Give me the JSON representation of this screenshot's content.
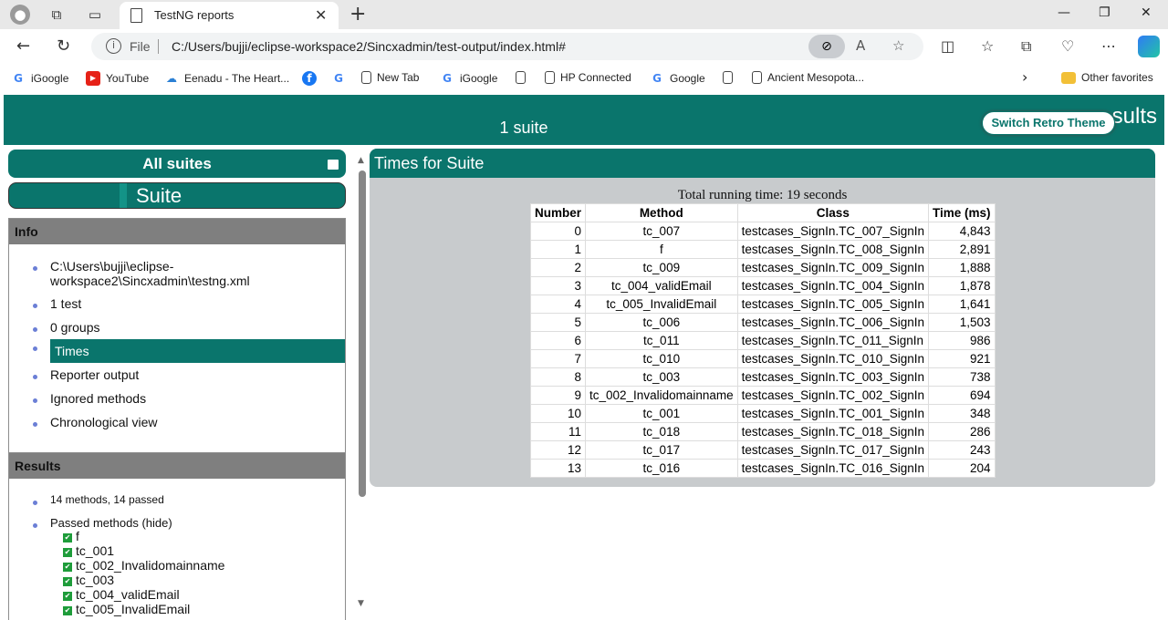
{
  "browser": {
    "tab_title": "TestNG reports",
    "url_label": "File",
    "url": "C:/Users/bujji/eclipse-workspace2/Sincxadmin/test-output/index.html#",
    "bookmarks": [
      "iGoogle",
      "YouTube",
      "Eenadu - The Heart...",
      "",
      "",
      "New Tab",
      "iGoogle",
      "",
      "HP Connected",
      "Google",
      "",
      "Ancient Mesopota..."
    ],
    "other_favorites": "Other favorites"
  },
  "report": {
    "suites_count": "1 suite",
    "title_fragment": "sults",
    "switch_theme": "Switch Retro Theme",
    "all_suites": "All suites",
    "suite_name": "Suite",
    "info_header": "Info",
    "info_items": [
      "C:\\Users\\bujji\\eclipse-workspace2\\Sincxadmin\\testng.xml",
      "1 test",
      "0 groups",
      "Times",
      "Reporter output",
      "Ignored methods",
      "Chronological view"
    ],
    "results_header": "Results",
    "results_summary": "14 methods, 14 passed",
    "passed_label": "Passed methods",
    "hide_label": "(hide)",
    "passed_methods": [
      "f",
      "tc_001",
      "tc_002_Invalidomainname",
      "tc_003",
      "tc_004_validEmail",
      "tc_005_InvalidEmail"
    ],
    "times_header": "Times for Suite",
    "total_time": "Total running time: 19 seconds",
    "columns": [
      "Number",
      "Method",
      "Class",
      "Time (ms)"
    ],
    "rows": [
      [
        "0",
        "tc_007",
        "testcases_SignIn.TC_007_SignIn",
        "4,843"
      ],
      [
        "1",
        "f",
        "testcases_SignIn.TC_008_SignIn",
        "2,891"
      ],
      [
        "2",
        "tc_009",
        "testcases_SignIn.TC_009_SignIn",
        "1,888"
      ],
      [
        "3",
        "tc_004_validEmail",
        "testcases_SignIn.TC_004_SignIn",
        "1,878"
      ],
      [
        "4",
        "tc_005_InvalidEmail",
        "testcases_SignIn.TC_005_SignIn",
        "1,641"
      ],
      [
        "5",
        "tc_006",
        "testcases_SignIn.TC_006_SignIn",
        "1,503"
      ],
      [
        "6",
        "tc_011",
        "testcases_SignIn.TC_011_SignIn",
        "986"
      ],
      [
        "7",
        "tc_010",
        "testcases_SignIn.TC_010_SignIn",
        "921"
      ],
      [
        "8",
        "tc_003",
        "testcases_SignIn.TC_003_SignIn",
        "738"
      ],
      [
        "9",
        "tc_002_Invalidomainname",
        "testcases_SignIn.TC_002_SignIn",
        "694"
      ],
      [
        "10",
        "tc_001",
        "testcases_SignIn.TC_001_SignIn",
        "348"
      ],
      [
        "11",
        "tc_018",
        "testcases_SignIn.TC_018_SignIn",
        "286"
      ],
      [
        "12",
        "tc_017",
        "testcases_SignIn.TC_017_SignIn",
        "243"
      ],
      [
        "13",
        "tc_016",
        "testcases_SignIn.TC_016_SignIn",
        "204"
      ]
    ]
  },
  "colors": {
    "accent": "#0a756c",
    "panel": "#c8cbcd",
    "section_header": "#7f7f7f"
  }
}
